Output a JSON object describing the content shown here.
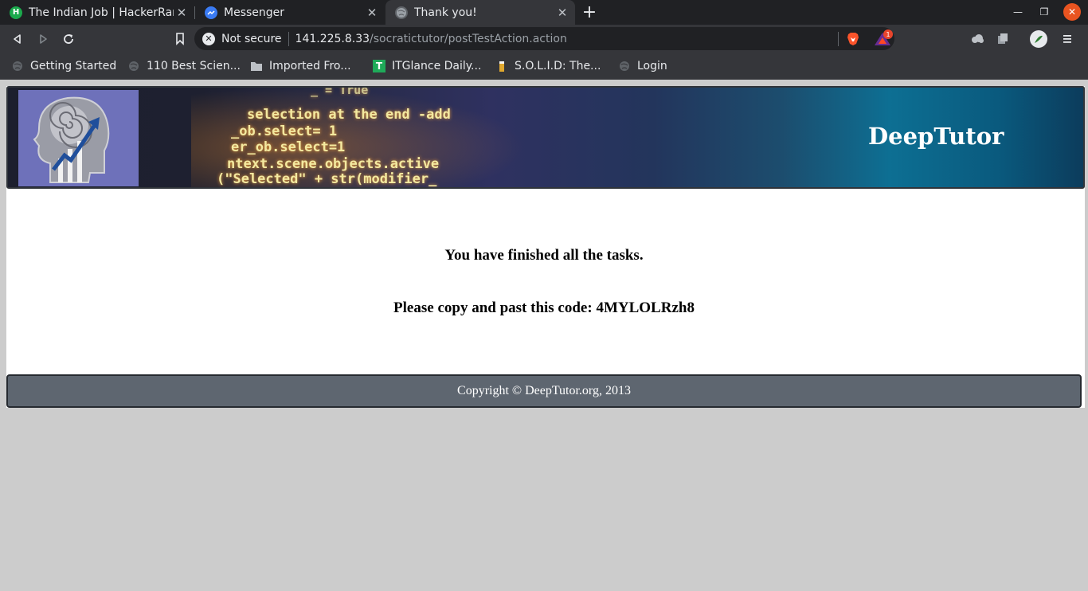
{
  "browser": {
    "tabs": [
      {
        "title": "The Indian Job | HackerRank",
        "favicon": "hackerrank-icon"
      },
      {
        "title": "Messenger",
        "favicon": "messenger-icon"
      },
      {
        "title": "Thank you!",
        "favicon": "globe-icon"
      }
    ],
    "address": {
      "security_label": "Not secure",
      "host": "141.225.8.33",
      "path": "/socratictutor/postTestAction.action"
    },
    "rewards_badge": "1",
    "bookmarks": [
      {
        "label": "Getting Started",
        "icon": "globe-icon"
      },
      {
        "label": "110 Best Scien...",
        "icon": "globe-icon"
      },
      {
        "label": "Imported Fro...",
        "icon": "folder-icon"
      },
      {
        "label": "ITGlance Daily...",
        "icon": "itglance-icon"
      },
      {
        "label": "S.O.L.I.D: The...",
        "icon": "beer-icon"
      },
      {
        "label": "Login",
        "icon": "globe-icon"
      }
    ]
  },
  "page": {
    "site_title": "DeepTutor",
    "code_lines": [
      "_ = True",
      "selection at the end -add",
      "_ob.select= 1",
      "er_ob.select=1",
      "ntext.scene.objects.active",
      "(\"Selected\" + str(modifier_"
    ],
    "message_finished": "You have finished all the tasks.",
    "message_code": "Please copy and past this code: 4MYLOLRzh8",
    "footer": "Copyright © DeepTutor.org, 2013"
  },
  "colors": {
    "chrome_dark": "#202124",
    "chrome_toolbar": "#35363a",
    "page_background": "#cccccc",
    "footer_bg": "#5e6670",
    "window_close": "#e95420"
  }
}
